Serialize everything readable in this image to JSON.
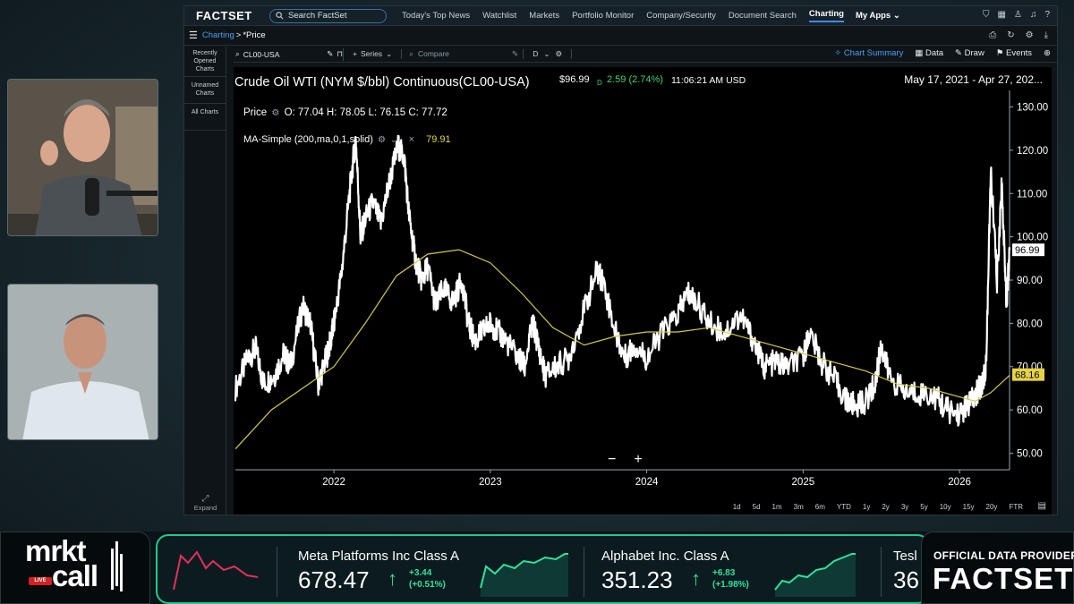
{
  "app": {
    "brand": "FACTSET",
    "search_placeholder": "Search FactSet",
    "nav": [
      "Today's Top News",
      "Watchlist",
      "Markets",
      "Portfolio Monitor",
      "Company/Security",
      "Document Search",
      "Charting"
    ],
    "active_nav": "Charting",
    "my_apps": "My Apps",
    "breadcrumb": {
      "section": "Charting",
      "separator": " >",
      "title": "*Price"
    },
    "sidebar": [
      "Recently Opened Charts",
      "Unnamed Charts",
      "All Charts"
    ],
    "expand_label": "Expand",
    "toolbar": {
      "symbol": "CL00-USA",
      "series_label": "Series",
      "compare_label": "Compare",
      "frequency": "D",
      "chart_summary": "Chart Summary",
      "data": "Data",
      "draw": "Draw",
      "events": "Events"
    },
    "chart_header": {
      "title": "Crude Oil WTI (NYM $/bbl) Continuous(CL00-USA)",
      "price": "$96.99",
      "d_marker": "D",
      "change": "2.59 (2.74%)",
      "time": "11:06:21 AM USD",
      "date_range": "May 17, 2021 - Apr 27, 202..."
    },
    "legend": {
      "price_label": "Price",
      "ohlc": "O: 77.04 H: 78.05 L: 76.15 C: 77.72",
      "ma_label": "MA-Simple (200,ma,0,1,solid)",
      "ma_value": "79.91"
    },
    "zoom": {
      "minus": "−",
      "plus": "+"
    },
    "ranges": [
      "1d",
      "5d",
      "1m",
      "3m",
      "6m",
      "YTD",
      "1y",
      "2y",
      "3y",
      "5y",
      "10y",
      "15y",
      "20y",
      "FTR"
    ]
  },
  "chart_data": {
    "type": "line",
    "title": "Crude Oil WTI (NYM $/bbl) Continuous(CL00-USA)",
    "x_tick_labels": [
      "2022",
      "2023",
      "2024",
      "2025",
      "2026"
    ],
    "y_tick_labels": [
      "50.00",
      "60.00",
      "70.00",
      "80.00",
      "90.00",
      "100.00",
      "110.00",
      "120.00",
      "130.00"
    ],
    "ylim": [
      47,
      133
    ],
    "y_axis_position": "right",
    "grid": false,
    "series": [
      {
        "name": "Price",
        "color": "#ffffff",
        "x": [
          2021.37,
          2021.45,
          2021.5,
          2021.55,
          2021.62,
          2021.68,
          2021.72,
          2021.8,
          2021.85,
          2021.9,
          2021.95,
          2021.98,
          2022.0,
          2022.05,
          2022.1,
          2022.14,
          2022.17,
          2022.2,
          2022.25,
          2022.3,
          2022.35,
          2022.41,
          2022.45,
          2022.48,
          2022.52,
          2022.56,
          2022.6,
          2022.65,
          2022.7,
          2022.76,
          2022.82,
          2022.86,
          2022.9,
          2022.95,
          2023.0,
          2023.05,
          2023.1,
          2023.18,
          2023.22,
          2023.27,
          2023.3,
          2023.35,
          2023.42,
          2023.5,
          2023.6,
          2023.68,
          2023.72,
          2023.8,
          2023.86,
          2023.92,
          2024.0,
          2024.1,
          2024.2,
          2024.26,
          2024.32,
          2024.4,
          2024.5,
          2024.6,
          2024.67,
          2024.75,
          2024.82,
          2024.9,
          2025.0,
          2025.04,
          2025.12,
          2025.2,
          2025.28,
          2025.33,
          2025.4,
          2025.46,
          2025.5,
          2025.55,
          2025.65,
          2025.75,
          2025.85,
          2025.92,
          2026.0,
          2026.05,
          2026.1,
          2026.14,
          2026.17,
          2026.2,
          2026.24,
          2026.27,
          2026.3,
          2026.32
        ],
        "values": [
          65,
          72,
          74,
          66,
          68,
          73,
          70,
          84,
          80,
          66,
          72,
          76,
          80,
          92,
          110,
          123,
          100,
          104,
          108,
          103,
          112,
          121,
          118,
          105,
          95,
          90,
          93,
          84,
          88,
          85,
          90,
          80,
          76,
          78,
          80,
          78,
          76,
          72,
          70,
          80,
          76,
          68,
          70,
          72,
          83,
          92,
          90,
          78,
          72,
          75,
          72,
          78,
          82,
          87,
          85,
          80,
          78,
          82,
          77,
          70,
          71,
          70,
          72,
          78,
          71,
          67,
          62,
          61,
          62,
          66,
          75,
          68,
          64,
          64,
          63,
          60,
          59,
          61,
          63,
          66,
          70,
          115,
          90,
          112,
          85,
          97
        ]
      },
      {
        "name": "MA-Simple (200,ma,0,1,solid)",
        "color": "#d4c94a",
        "x": [
          2021.37,
          2021.6,
          2021.8,
          2022.0,
          2022.2,
          2022.4,
          2022.6,
          2022.8,
          2023.0,
          2023.2,
          2023.4,
          2023.6,
          2023.8,
          2024.0,
          2024.2,
          2024.4,
          2024.6,
          2024.8,
          2025.0,
          2025.2,
          2025.4,
          2025.6,
          2025.8,
          2026.0,
          2026.1,
          2026.2,
          2026.32
        ],
        "values": [
          51,
          60,
          65,
          70,
          80,
          91,
          96,
          97,
          94,
          87,
          79,
          75,
          77,
          78,
          78,
          79,
          77,
          75,
          73,
          71,
          69,
          66,
          65,
          63,
          62,
          64,
          68
        ]
      }
    ],
    "last_price_label": "96.99",
    "ma_last_label": "68.16"
  },
  "webcam": {
    "live_badge": "LIVE"
  },
  "ticker_strip": {
    "show_brand_top": "mrkt",
    "show_brand_bottom": "call",
    "items": [
      {
        "name": "Meta Platforms Inc Class A",
        "price": "678.47",
        "change": "+3.44",
        "change_pct": "(+0.51%)"
      },
      {
        "name": "Alphabet Inc. Class A",
        "price": "351.23",
        "change": "+6.83",
        "change_pct": "(+1.98%)"
      },
      {
        "name": "Tesl",
        "price": "36",
        "change": "",
        "change_pct": ""
      }
    ],
    "provider_label": "OFFICIAL DATA PROVIDER",
    "provider_name": "FACTSET",
    "colors": {
      "accent": "#1fc98e",
      "up": "#2fe39c",
      "down": "#e0325a"
    }
  }
}
